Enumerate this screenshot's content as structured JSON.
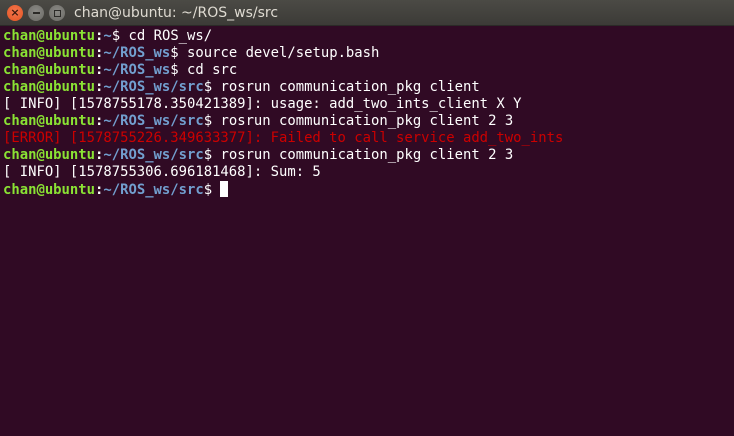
{
  "window": {
    "title": "chan@ubuntu: ~/ROS_ws/src"
  },
  "icons": {
    "close": "close-icon",
    "minimize": "minimize-icon",
    "maximize": "maximize-icon"
  },
  "colors": {
    "background": "#300a24",
    "prompt_user": "#8ae234",
    "prompt_path": "#729fcf",
    "error": "#cc0000"
  },
  "terminal": {
    "lines": [
      {
        "user": "chan@ubuntu",
        "path": "~",
        "command": "cd ROS_ws/"
      },
      {
        "user": "chan@ubuntu",
        "path": "~/ROS_ws",
        "command": "source devel/setup.bash"
      },
      {
        "user": "chan@ubuntu",
        "path": "~/ROS_ws",
        "command": "cd src"
      },
      {
        "user": "chan@ubuntu",
        "path": "~/ROS_ws/src",
        "command": "rosrun communication_pkg client"
      },
      {
        "output": "[ INFO] [1578755178.350421389]: usage: add_two_ints_client X Y"
      },
      {
        "user": "chan@ubuntu",
        "path": "~/ROS_ws/src",
        "command": "rosrun communication_pkg client 2 3"
      },
      {
        "error": "[ERROR] [1578755226.349633377]: Failed to call service add_two_ints"
      },
      {
        "user": "chan@ubuntu",
        "path": "~/ROS_ws/src",
        "command": "rosrun communication_pkg client 2 3"
      },
      {
        "output": "[ INFO] [1578755306.696181468]: Sum: 5"
      },
      {
        "user": "chan@ubuntu",
        "path": "~/ROS_ws/src",
        "command": ""
      }
    ]
  }
}
